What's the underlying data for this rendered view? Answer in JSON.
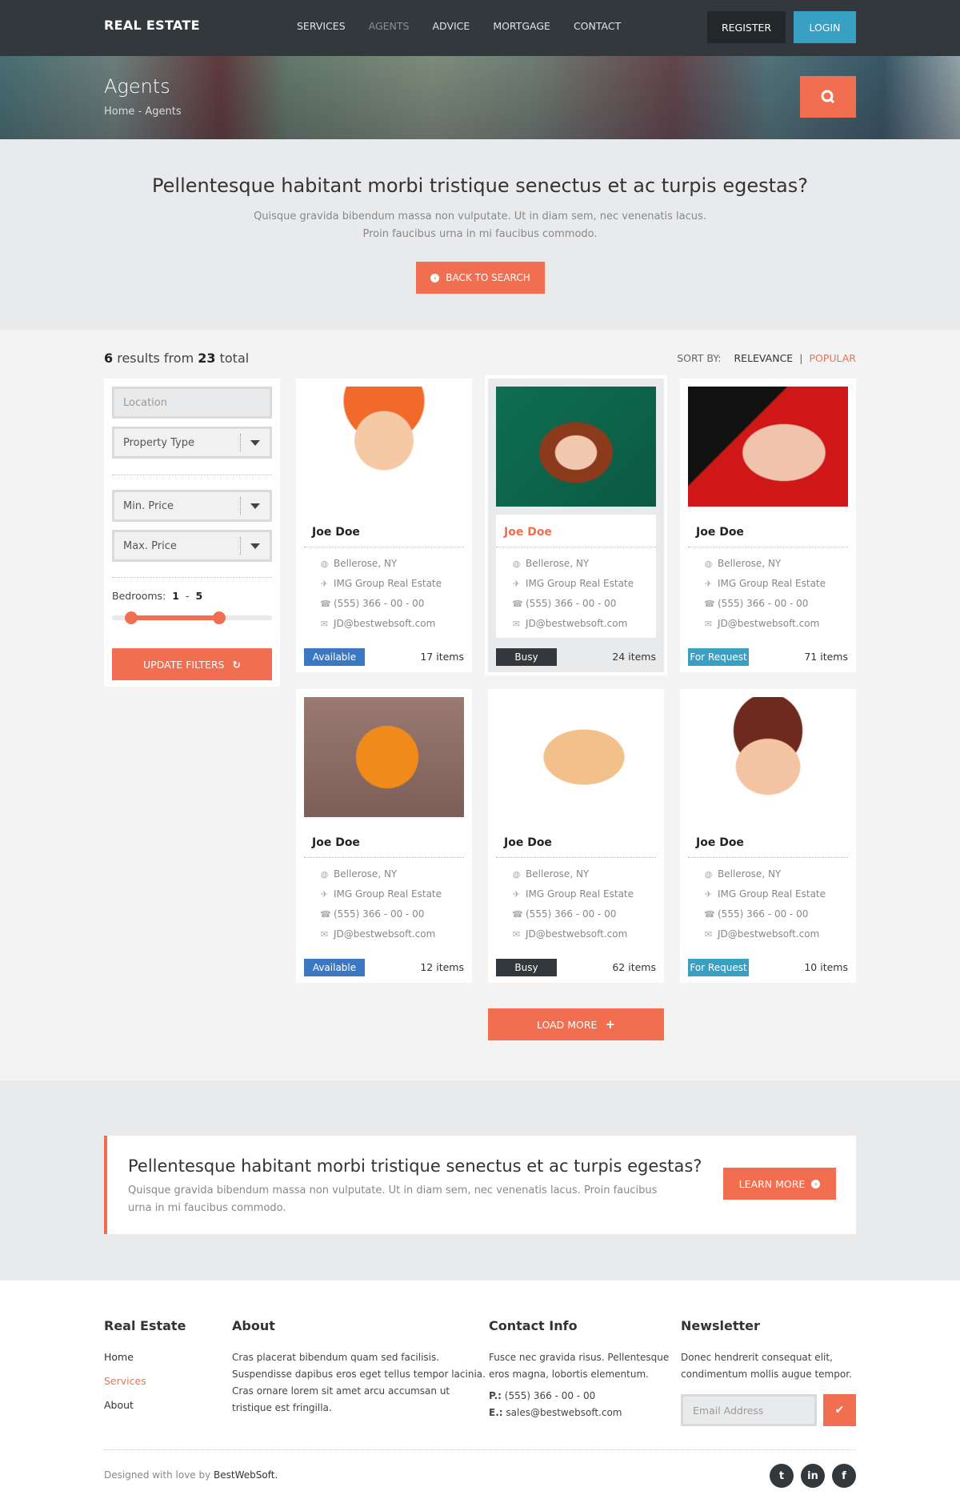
{
  "header": {
    "logo": "REAL ESTATE",
    "nav": [
      {
        "label": "SERVICES",
        "active": false
      },
      {
        "label": "AGENTS",
        "active": true
      },
      {
        "label": "ADVICE",
        "active": false
      },
      {
        "label": "MORTGAGE",
        "active": false
      },
      {
        "label": "CONTACT",
        "active": false
      }
    ],
    "register_label": "REGISTER",
    "login_label": "LOGIN"
  },
  "banner": {
    "title": "Agents",
    "breadcrumb": "Home - Agents",
    "search_icon": "search-icon"
  },
  "intro": {
    "heading": "Pellentesque habitant morbi tristique senectus et ac turpis egestas?",
    "text": "Quisque gravida bibendum massa non vulputate. Ut in diam sem, nec venenatis lacus. Proin faucibus urna in mi faucibus commodo.",
    "back_label": "BACK TO SEARCH"
  },
  "results": {
    "shown": "6",
    "mid": "results from",
    "total": "23",
    "suffix": "total"
  },
  "sort": {
    "label": "SORT BY:",
    "options": [
      "RELEVANCE",
      "POPULAR"
    ],
    "separator": "|"
  },
  "filters": {
    "location_placeholder": "Location",
    "property_type": "Property Type",
    "min_price": "Min. Price",
    "max_price": "Max. Price",
    "bedrooms_label": "Bedrooms:",
    "bedrooms_min": "1",
    "bedrooms_sep": "-",
    "bedrooms_max": "5",
    "update_label": "UPDATE FILTERS"
  },
  "agents": [
    {
      "name": "Joe Doe",
      "location": "Bellerose, NY",
      "company": "IMG Group Real Estate",
      "phone": "(555) 366 - 00 - 00",
      "email": "JD@bestwebsoft.com",
      "status": "Available",
      "items": "17 items"
    },
    {
      "name": "Joe Doe",
      "location": "Bellerose, NY",
      "company": "IMG Group Real Estate",
      "phone": "(555) 366 - 00 - 00",
      "email": "JD@bestwebsoft.com",
      "status": "Busy",
      "items": "24 items"
    },
    {
      "name": "Joe Doe",
      "location": "Bellerose, NY",
      "company": "IMG Group Real Estate",
      "phone": "(555) 366 - 00 - 00",
      "email": "JD@bestwebsoft.com",
      "status": "For Request",
      "items": "71 items"
    },
    {
      "name": "Joe Doe",
      "location": "Bellerose, NY",
      "company": "IMG Group Real Estate",
      "phone": "(555) 366 - 00 - 00",
      "email": "JD@bestwebsoft.com",
      "status": "Available",
      "items": "12 items"
    },
    {
      "name": "Joe Doe",
      "location": "Bellerose, NY",
      "company": "IMG Group Real Estate",
      "phone": "(555) 366 - 00 - 00",
      "email": "JD@bestwebsoft.com",
      "status": "Busy",
      "items": "62 items"
    },
    {
      "name": "Joe Doe",
      "location": "Bellerose, NY",
      "company": "IMG Group Real Estate",
      "phone": "(555) 366 - 00 - 00",
      "email": "JD@bestwebsoft.com",
      "status": "For Request",
      "items": "10 items"
    }
  ],
  "load_more_label": "LOAD MORE",
  "cta": {
    "heading": "Pellentesque habitant morbi tristique senectus et ac turpis egestas?",
    "text": "Quisque gravida bibendum massa non vulputate. Ut in diam sem, nec venenatis lacus. Proin faucibus urna in mi faucibus commodo.",
    "button_label": "LEARN MORE"
  },
  "footer": {
    "col1_title": "Real Estate",
    "links": [
      {
        "label": "Home",
        "active": false
      },
      {
        "label": "Services",
        "active": true
      },
      {
        "label": "About",
        "active": false
      }
    ],
    "about_title": "About",
    "about_text": [
      "Cras placerat bibendum quam sed facilisis.",
      "Suspendisse dapibus eros eget tellus tempor lacinia.",
      "Cras ornare lorem sit amet arcu accumsan ut",
      "tristique est fringilla."
    ],
    "contact_title": "Contact Info",
    "contact_text": [
      "Fusce nec gravida risus. Pellentesque",
      "eros magna, lobortis elementum."
    ],
    "phone_label": "P.:",
    "phone": "(555) 366 - 00 - 00",
    "email_label": "E.:",
    "email": "sales@bestwebsoft.com",
    "newsletter_title": "Newsletter",
    "newsletter_text": [
      "Donec hendrerit consequat elit,",
      "condimentum mollis augue tempor."
    ],
    "email_placeholder": "Email Address",
    "credit_prefix": "Designed with love by",
    "credit_brand": "BestWebSoft.",
    "social": [
      "twitter",
      "linkedin",
      "facebook"
    ]
  },
  "colors": {
    "accent": "#f16f50",
    "header_bg": "#33383d",
    "login_bg": "#38a0c2",
    "available": "#3a78c3",
    "busy": "#33383d",
    "for_request": "#38a0c2"
  }
}
